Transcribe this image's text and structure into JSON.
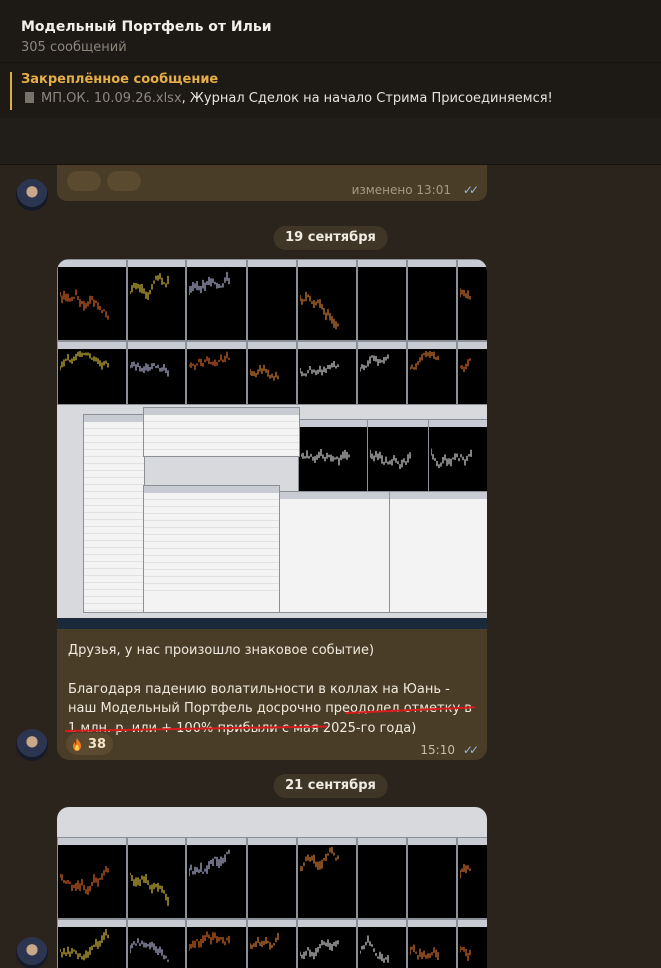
{
  "header": {
    "title": "Модельный Портфель от Ильи",
    "subtitle": "305 сообщений"
  },
  "pinned": {
    "label": "Закреплённое сообщение",
    "file_name": "МП.ОК. 10.09.26.xlsx",
    "text": ", Журнал Сделок на начало Стрима  Присоединяемся!"
  },
  "previous_message": {
    "time": "изменено 13:01"
  },
  "dates": {
    "first": "19 сентября",
    "second": "21 сентября"
  },
  "message": {
    "paragraph1": "Друзья, у нас произошло знаковое событие)",
    "paragraph2": "Благодаря падению волатильности в коллах на Юань - наш Модельный Портфель досрочно преодолел отметку в 1 млн. р. или + 100% прибыли с мая 2025-го года)",
    "reaction_emoji": "fire-icon",
    "reaction_count": "38",
    "time": "15:10"
  },
  "colors": {
    "accent": "#e5ad47",
    "bubble": "#4a3d28",
    "underline": "#d71c1c",
    "check": "#8fb8d8"
  }
}
